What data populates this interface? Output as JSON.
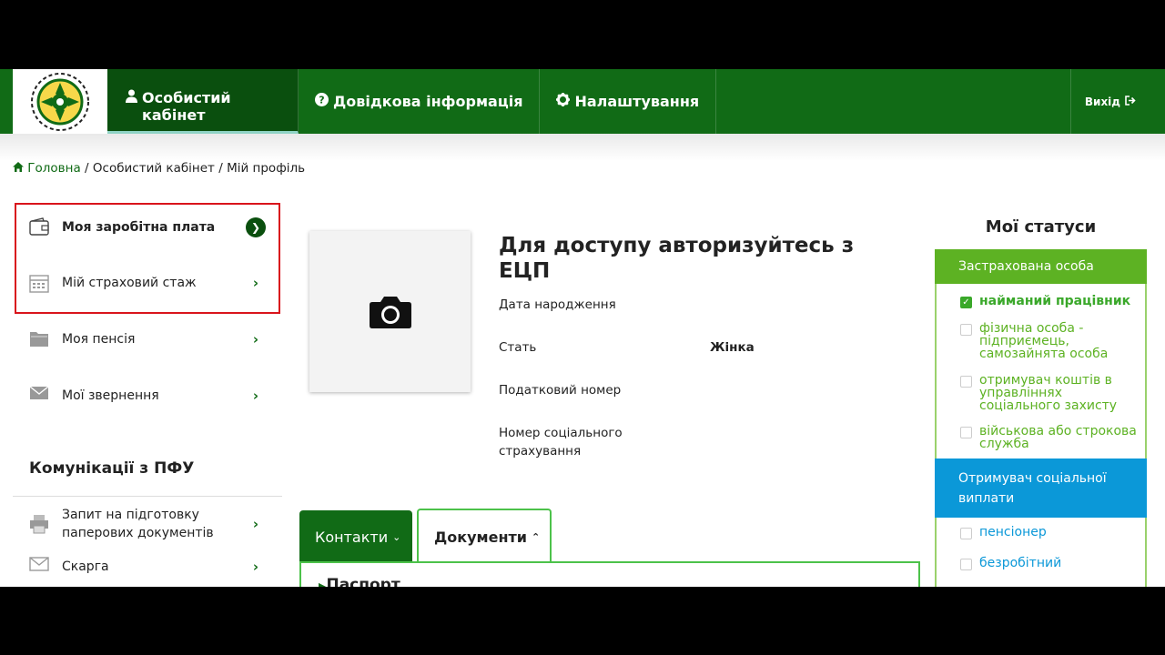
{
  "nav": {
    "items": [
      {
        "label": "Особистий кабінет",
        "icon": "user-icon"
      },
      {
        "label": "Довідкова інформація",
        "icon": "question-circle-icon"
      },
      {
        "label": "Налаштування",
        "icon": "gear-icon"
      }
    ],
    "exit_label": "Вихід",
    "exit_icon": "sign-out-icon",
    "colors": {
      "bar": "#116b16",
      "active": "#0a4f0e"
    }
  },
  "breadcrumb": {
    "home": "Головна",
    "separator": "/",
    "crumb_2": "Особистий кабінет",
    "crumb_3": "Мій профіль"
  },
  "sidebar": {
    "items": [
      {
        "label": "Моя заробітна плата",
        "icon": "wallet-icon"
      },
      {
        "label": "Мій страховий стаж",
        "icon": "calendar-icon"
      },
      {
        "label": "Моя пенсія",
        "icon": "folder-icon"
      },
      {
        "label": "Мої звернення",
        "icon": "envelope-icon"
      }
    ],
    "communications_heading": "Комунікації з ПФУ",
    "communications": [
      {
        "label": "Запит на підготовку паперових документів",
        "icon": "printer-icon"
      },
      {
        "label": "Скарга",
        "icon": "complaint-icon"
      }
    ],
    "highlight_color": "#d9141c"
  },
  "profile": {
    "photo_icon": "camera-icon",
    "title": "Для доступу авторизуйтесь з ЕЦП",
    "fields": {
      "birth_date_label": "Дата народження",
      "gender_label": "Стать",
      "gender_value": "Жінка",
      "tax_number_label": "Податковий номер",
      "social_number_label": "Номер соціального страхування"
    }
  },
  "tabs": {
    "contacts": "Контакти",
    "documents": "Документи",
    "panel_heading": "Паспорт"
  },
  "statuses": {
    "title": "Мої статуси",
    "insured_heading": "Застрахована особа",
    "insured": [
      {
        "label": "найманий працівник",
        "checked": true
      },
      {
        "label": "фізична особа - підприємець, самозайнята особа",
        "checked": false
      },
      {
        "label": "отримувач коштів в управліннях соціального захисту",
        "checked": false
      },
      {
        "label": "військова або строкова служба",
        "checked": false
      }
    ],
    "recipient_heading": "Отримувач соціальної виплати",
    "recipient": [
      {
        "label": "пенсіонер",
        "checked": false
      },
      {
        "label": "безробітний",
        "checked": false
      }
    ],
    "colors": {
      "insured": "#5db223",
      "recipient": "#0b98d8"
    }
  }
}
